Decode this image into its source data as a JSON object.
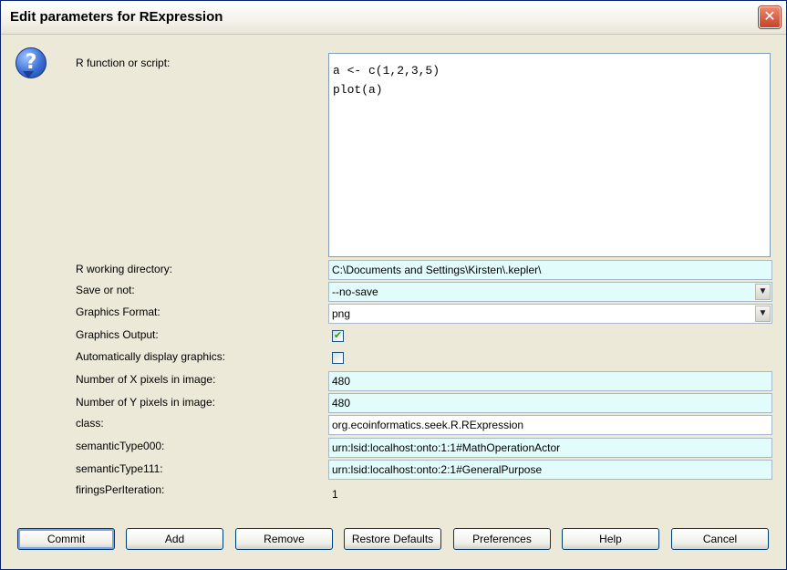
{
  "window": {
    "title": "Edit parameters for RExpression",
    "close_glyph": "✕"
  },
  "icons": {
    "help": "?"
  },
  "fields": {
    "script": {
      "label": "R function or script:",
      "value": "a <- c(1,2,3,5)\nplot(a)"
    },
    "working_dir": {
      "label": "R working directory:",
      "value": "C:\\Documents and Settings\\Kirsten\\.kepler\\"
    },
    "save": {
      "label": "Save or not:",
      "value": "--no-save"
    },
    "graphics_format": {
      "label": "Graphics Format:",
      "value": "png"
    },
    "graphics_output": {
      "label": "Graphics Output:",
      "checked": true,
      "check_glyph": "✔"
    },
    "auto_display": {
      "label": "Automatically display graphics:",
      "checked": false,
      "check_glyph": ""
    },
    "x_pixels": {
      "label": "Number of X pixels in image:",
      "value": "480"
    },
    "y_pixels": {
      "label": "Number of Y pixels in image:",
      "value": "480"
    },
    "class": {
      "label": "class:",
      "value": "org.ecoinformatics.seek.R.RExpression"
    },
    "semantic_000": {
      "label": "semanticType000:",
      "value": "urn:lsid:localhost:onto:1:1#MathOperationActor"
    },
    "semantic_111": {
      "label": "semanticType111:",
      "value": "urn:lsid:localhost:onto:2:1#GeneralPurpose"
    },
    "firings": {
      "label": "firingsPerIteration:",
      "value": "1"
    }
  },
  "dropdown_glyph": "▼",
  "buttons": {
    "commit": "Commit",
    "add": "Add",
    "remove": "Remove",
    "restore_defaults": "Restore Defaults",
    "preferences": "Preferences",
    "help": "Help",
    "cancel": "Cancel"
  },
  "colors": {
    "field_background": "#e2fcfc",
    "dialog_background": "#ece9d8",
    "close_button": "#c8412a"
  }
}
